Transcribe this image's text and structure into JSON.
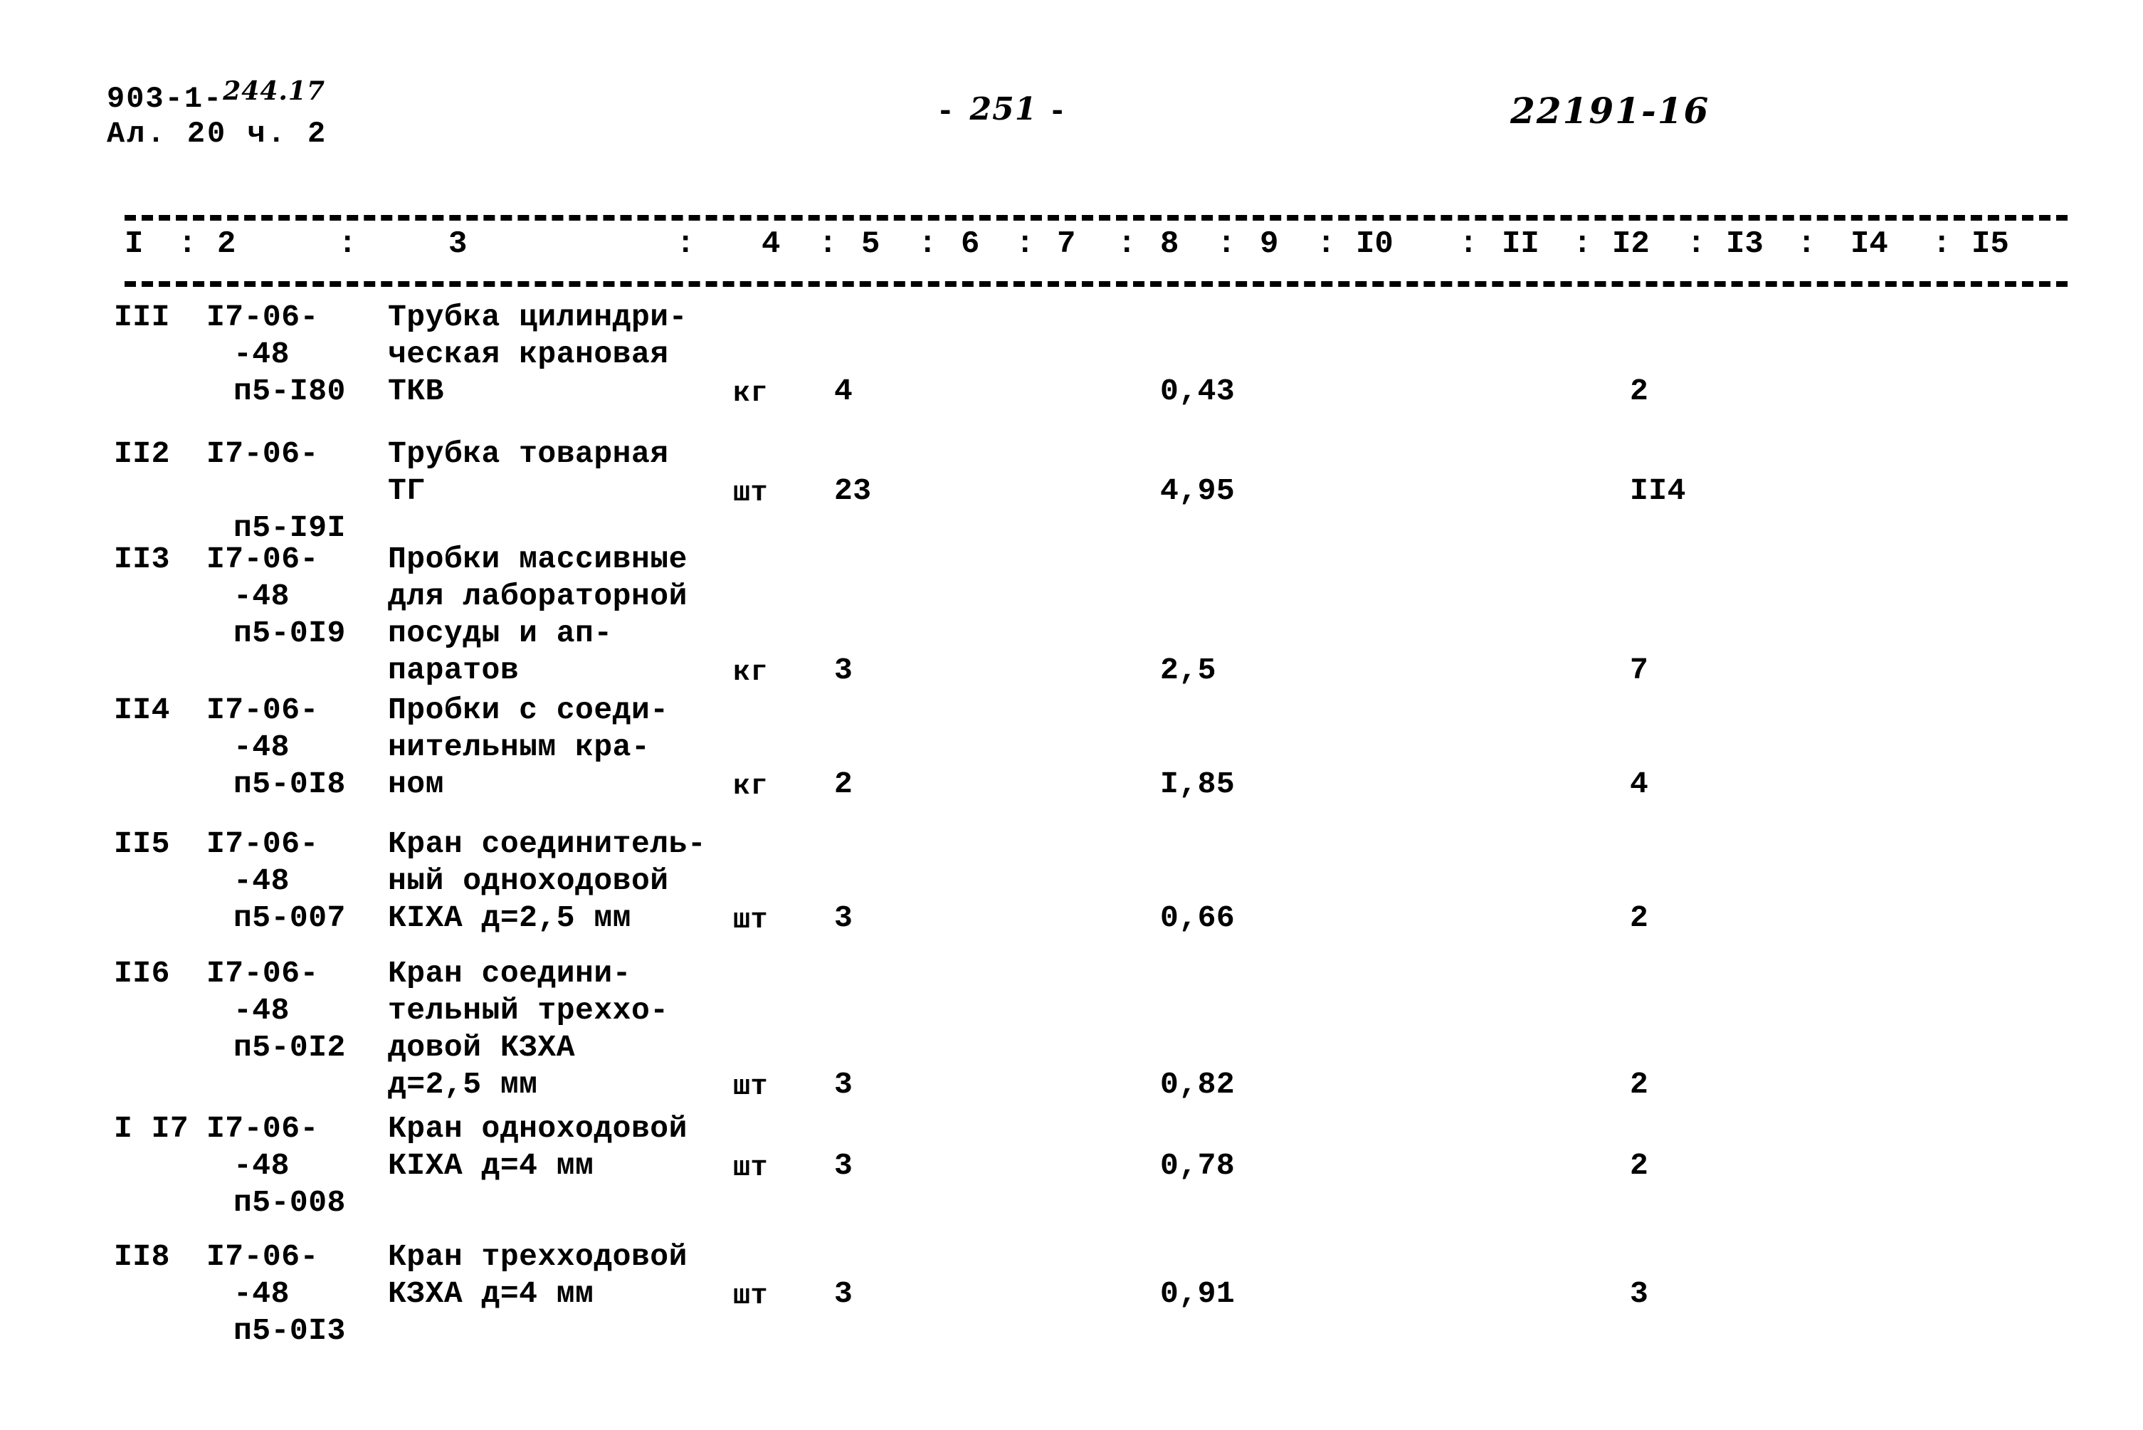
{
  "header": {
    "doc_code_prefix": "903-1-",
    "doc_code_handwritten": "244.17",
    "album_line": "Ал. 20   ч. 2",
    "page_dash_left": "-",
    "page_number": "251",
    "page_dash_right": "-",
    "stamp_number": "22191-16"
  },
  "column_numbers": [
    "I",
    "2",
    "3",
    "4",
    "5",
    "6",
    "7",
    "8",
    "9",
    "I0",
    "II",
    "I2",
    "I3",
    "I4",
    "I5"
  ],
  "column_separator": ":",
  "table": {
    "rows": [
      {
        "num": "III",
        "code_line1": "I7-06-",
        "code_line2": "-48",
        "code_line3": "п5-I80",
        "desc": "Трубка цилиндри-\nческая крановая\nТКВ",
        "unit": "кг",
        "qty": "4",
        "price": "0,43",
        "total": "2"
      },
      {
        "num": "II2",
        "code_line1": "I7-06-",
        "code_line2": "",
        "code_line3": "п5-I9I",
        "desc": "Трубка товарная\nТГ",
        "unit": "шт",
        "qty": "23",
        "price": "4,95",
        "total": "II4"
      },
      {
        "num": "II3",
        "code_line1": "I7-06-",
        "code_line2": "-48",
        "code_line3": "п5-0I9",
        "desc": "Пробки массивные\nдля лабораторной\nпосуды и ап-\nпаратов",
        "unit": "кг",
        "qty": "3",
        "price": "2,5",
        "total": "7"
      },
      {
        "num": "II4",
        "code_line1": "I7-06-",
        "code_line2": "-48",
        "code_line3": "п5-0I8",
        "desc": "Пробки с соеди-\nнительным кра-\nном",
        "unit": "кг",
        "qty": "2",
        "price": "I,85",
        "total": "4"
      },
      {
        "num": "II5",
        "code_line1": "I7-06-",
        "code_line2": "-48",
        "code_line3": "п5-007",
        "desc": "Кран соединитель-\nный одноходовой\nКIХА д=2,5 мм",
        "unit": "шт",
        "qty": "3",
        "price": "0,66",
        "total": "2"
      },
      {
        "num": "II6",
        "code_line1": "I7-06-",
        "code_line2": "-48",
        "code_line3": "п5-0I2",
        "desc": "Кран соедини-\nтельный треххо-\nдовой КЗХА\nд=2,5 мм",
        "unit": "шт",
        "qty": "3",
        "price": "0,82",
        "total": "2"
      },
      {
        "num": "I I7",
        "code_line1": "I7-06-",
        "code_line2": "-48",
        "code_line3": "п5-008",
        "desc": "Кран одноходовой\nКIХА д=4 мм",
        "unit": "шт",
        "qty": "3",
        "price": "0,78",
        "total": "2"
      },
      {
        "num": "II8",
        "code_line1": "I7-06-",
        "code_line2": "-48",
        "code_line3": "п5-0I3",
        "desc": "Кран трехходовой\nКЗХА д=4 мм",
        "unit": "шт",
        "qty": "3",
        "price": "0,91",
        "total": "3"
      }
    ]
  }
}
